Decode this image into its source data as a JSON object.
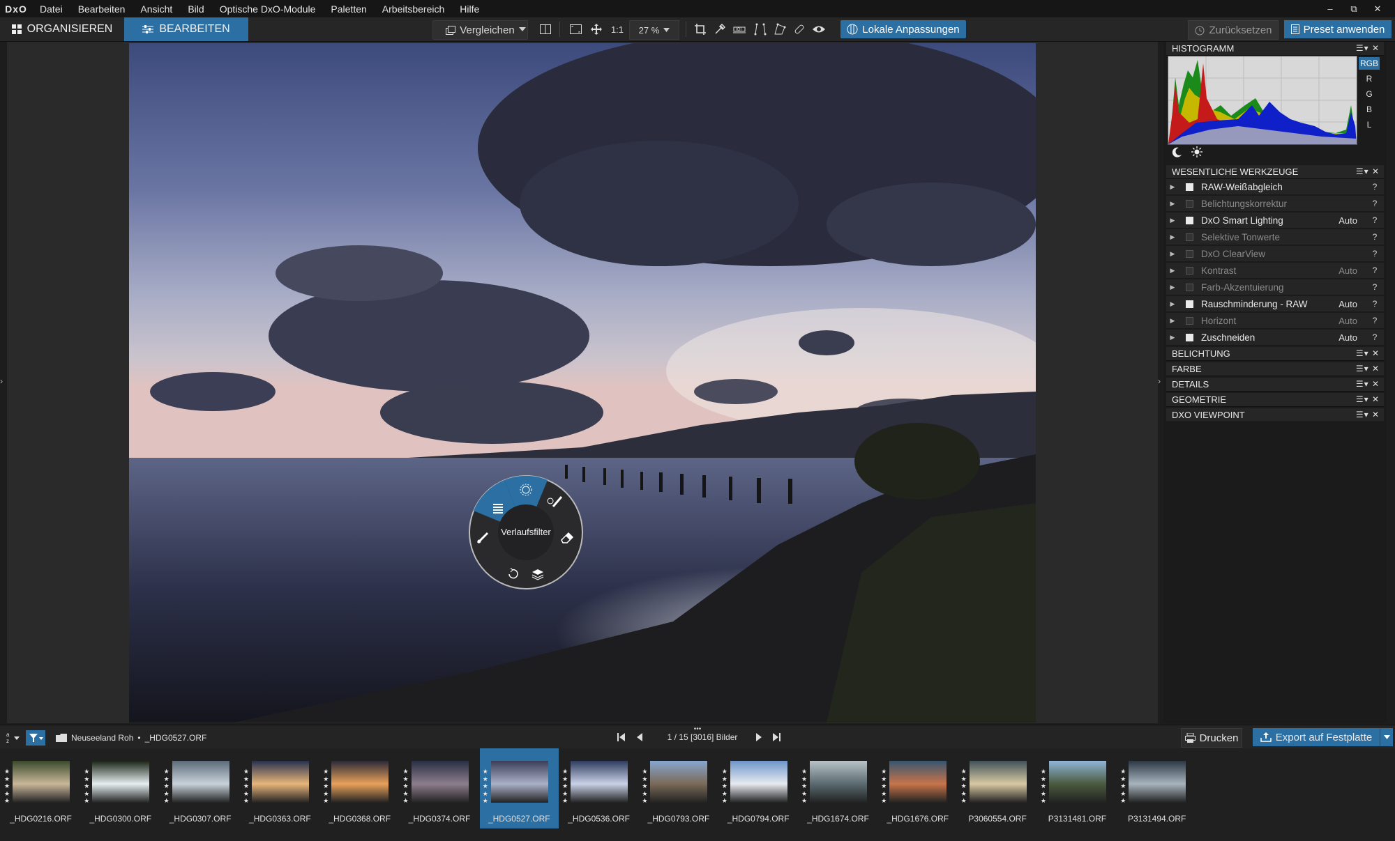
{
  "app": {
    "logo": "DxO"
  },
  "menu": [
    "Datei",
    "Bearbeiten",
    "Ansicht",
    "Bild",
    "Optische DxO-Module",
    "Paletten",
    "Arbeitsbereich",
    "Hilfe"
  ],
  "window_controls": [
    "–",
    "⧉",
    "✕"
  ],
  "tabs": {
    "organize": "ORGANISIEREN",
    "edit": "BEARBEITEN"
  },
  "toolbar": {
    "compare": "Vergleichen",
    "one_to_one": "1:1",
    "zoom": "27 %",
    "local_adjust": "Lokale Anpassungen",
    "reset": "Zurücksetzen",
    "apply_preset": "Preset anwenden"
  },
  "radial_menu": {
    "center_label": "Verlaufsfilter"
  },
  "histogram": {
    "title": "HISTOGRAMM",
    "channels": [
      "RGB",
      "R",
      "G",
      "B",
      "L"
    ],
    "active_channel": "RGB"
  },
  "essential_tools": {
    "title": "WESENTLICHE WERKZEUGE",
    "items": [
      {
        "label": "RAW-Weißabgleich",
        "active": true,
        "auto": ""
      },
      {
        "label": "Belichtungskorrektur",
        "active": false,
        "auto": ""
      },
      {
        "label": "DxO Smart Lighting",
        "active": true,
        "auto": "Auto"
      },
      {
        "label": "Selektive Tonwerte",
        "active": false,
        "auto": ""
      },
      {
        "label": "DxO ClearView",
        "active": false,
        "auto": ""
      },
      {
        "label": "Kontrast",
        "active": false,
        "auto": "Auto"
      },
      {
        "label": "Farb-Akzentuierung",
        "active": false,
        "auto": ""
      },
      {
        "label": "Rauschminderung - RAW",
        "active": true,
        "auto": "Auto"
      },
      {
        "label": "Horizont",
        "active": false,
        "auto": "Auto"
      },
      {
        "label": "Zuschneiden",
        "active": true,
        "auto": "Auto"
      }
    ]
  },
  "palettes": [
    "BELICHTUNG",
    "FARBE",
    "DETAILS",
    "GEOMETRIE",
    "DXO VIEWPOINT"
  ],
  "bottom": {
    "path_folder": "Neuseeland Roh",
    "path_file": "_HDG0527.ORF",
    "counter": "1 / 15 [3016] Bilder",
    "print": "Drucken",
    "export": "Export auf Festplatte"
  },
  "filmstrip": [
    {
      "name": "_HDG0216.ORF",
      "selected": false
    },
    {
      "name": "_HDG0300.ORF",
      "selected": false
    },
    {
      "name": "_HDG0307.ORF",
      "selected": false
    },
    {
      "name": "_HDG0363.ORF",
      "selected": false
    },
    {
      "name": "_HDG0368.ORF",
      "selected": false
    },
    {
      "name": "_HDG0374.ORF",
      "selected": false
    },
    {
      "name": "_HDG0527.ORF",
      "selected": true
    },
    {
      "name": "_HDG0536.ORF",
      "selected": false
    },
    {
      "name": "_HDG0793.ORF",
      "selected": false
    },
    {
      "name": "_HDG0794.ORF",
      "selected": false
    },
    {
      "name": "_HDG1674.ORF",
      "selected": false
    },
    {
      "name": "_HDG1676.ORF",
      "selected": false
    },
    {
      "name": "P3060554.ORF",
      "selected": false
    },
    {
      "name": "P3131481.ORF",
      "selected": false
    },
    {
      "name": "P3131494.ORF",
      "selected": false
    }
  ],
  "colors": {
    "accent": "#2b6fa3",
    "background": "#1d1d1d",
    "panel": "#252525"
  }
}
